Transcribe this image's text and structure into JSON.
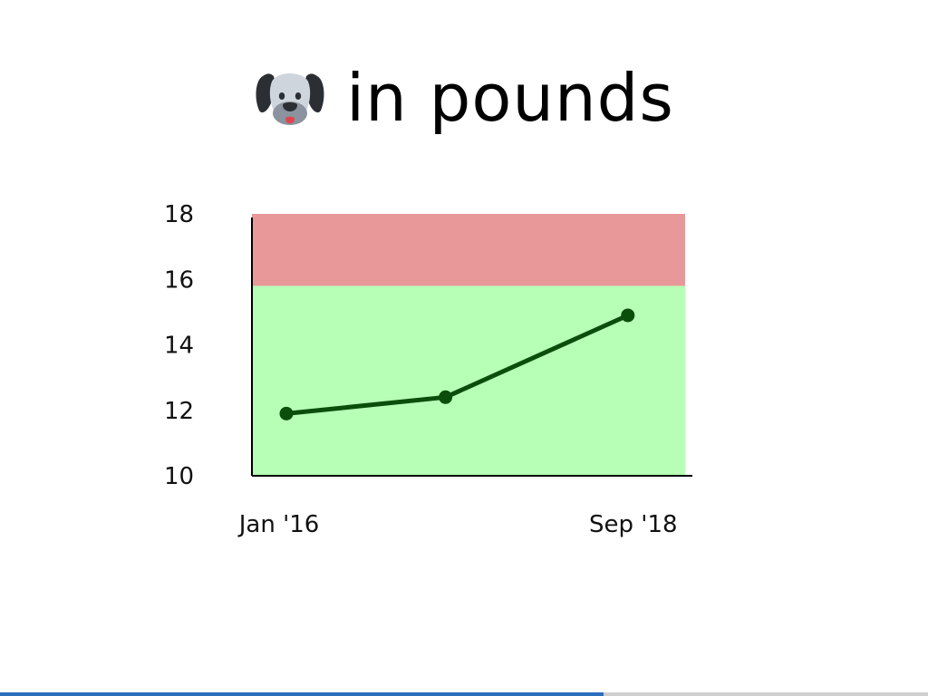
{
  "title": {
    "icon": "dog-face-icon",
    "text": "in pounds"
  },
  "chart_data": {
    "type": "line",
    "title": "in pounds",
    "ylim": [
      10,
      18
    ],
    "y_ticks": [
      "18",
      "16",
      "14",
      "12",
      "10"
    ],
    "x_tick_labels": [
      "Jan '16",
      "Sep '18"
    ],
    "bands": [
      {
        "from": 10,
        "to": 15.8,
        "color": "#b7ffb7"
      },
      {
        "from": 15.8,
        "to": 18.2,
        "color": "#e89898"
      }
    ],
    "series": [
      {
        "color": "#0b4d0b",
        "points": [
          {
            "x": "2016-01",
            "y": 11.9
          },
          {
            "x": "2017-03",
            "y": 12.4
          },
          {
            "x": "2018-07",
            "y": 14.9
          }
        ]
      }
    ],
    "grid": false,
    "legend": "none"
  },
  "progress": {
    "value": 0.65,
    "color": "#2a6ebd"
  }
}
